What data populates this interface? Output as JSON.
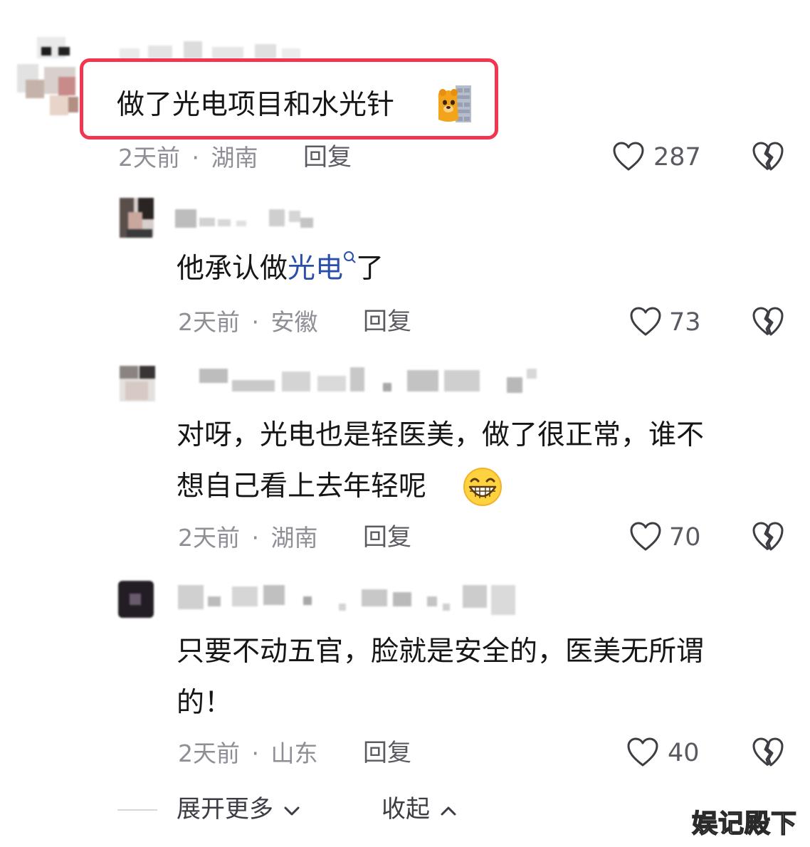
{
  "comments": [
    {
      "text": "做了光电项目和水光针",
      "emoji": "bear-peeking-emoji",
      "time": "2天前",
      "location": "湖南",
      "reply_label": "回复",
      "likes": "287"
    },
    {
      "text_before": "他承认做",
      "keyword": "光电",
      "text_after": "了",
      "time": "2天前",
      "location": "安徽",
      "reply_label": "回复",
      "likes": "73"
    },
    {
      "line1": "对呀，光电也是轻医美，做了很正常，谁不",
      "line2": "想自己看上去年轻呢",
      "emoji": "grin-emoji",
      "time": "2天前",
      "location": "湖南",
      "reply_label": "回复",
      "likes": "70"
    },
    {
      "line1": "只要不动五官，脸就是安全的，医美无所谓",
      "line2": "的！",
      "time": "2天前",
      "location": "山东",
      "reply_label": "回复",
      "likes": "40"
    }
  ],
  "meta_separator": "·",
  "footer": {
    "expand_label": "展开更多",
    "collapse_label": "收起"
  },
  "watermark": "娱记殿下",
  "colors": {
    "highlight_border": "#f2364f",
    "keyword": "#2a4fa8",
    "meta": "#8e8e96"
  }
}
